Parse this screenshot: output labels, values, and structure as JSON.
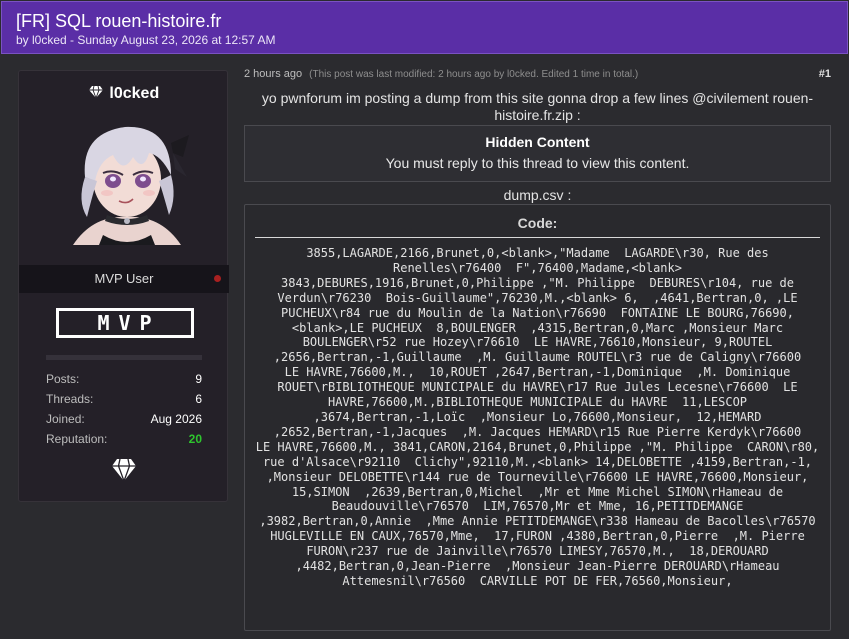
{
  "thread": {
    "title": "[FR] SQL rouen-histoire.fr",
    "byline": "by l0cked - Sunday August 23, 2026 at 12:57 AM"
  },
  "author": {
    "username": "l0cked",
    "rank": "MVP User",
    "badge": "MVP",
    "stats": [
      {
        "label": "Posts:",
        "value": "9"
      },
      {
        "label": "Threads:",
        "value": "6"
      },
      {
        "label": "Joined:",
        "value": "Aug 2026"
      },
      {
        "label": "Reputation:",
        "value": "20"
      }
    ]
  },
  "post": {
    "time_ago": "2 hours ago",
    "edit_note": "(This post was last modified: 2 hours ago by l0cked. Edited 1 time in total.)",
    "number": "#1",
    "message": "yo pwnforum im posting a dump from this site gonna drop a few lines @civilement rouen-histoire.fr.zip :",
    "hidden_title": "Hidden Content",
    "hidden_text": "You must reply to this thread to view this content.",
    "dump_label": "dump.csv :",
    "code_header": "Code:",
    "code": "3855,LAGARDE,2166,Brunet,0,<blank>,\"Madame  LAGARDE\\r30, Rue des Renelles\\r76400  F\",76400,Madame,<blank>\n3843,DEBURES,1916,Brunet,0,Philippe ,\"M. Philippe  DEBURES\\r104, rue de Verdun\\r76230  Bois-Guillaume\",76230,M.,<blank> 6,  ,4641,Bertran,0, ,LE PUCHEUX\\r84 rue du Moulin de la Nation\\r76690  FONTAINE LE BOURG,76690,<blank>,LE PUCHEUX  8,BOULENGER  ,4315,Bertran,0,Marc ,Monsieur Marc BOULENGER\\r52 rue Hozey\\r76610  LE HAVRE,76610,Monsieur, 9,ROUTEL  ,2656,Bertran,-1,Guillaume  ,M. Guillaume ROUTEL\\r3 rue de Caligny\\r76600     LE HAVRE,76600,M.,  10,ROUET ,2647,Bertran,-1,Dominique  ,M. Dominique ROUET\\rBIBLIOTHEQUE MUNICIPALE du HAVRE\\r17 Rue Jules Lecesne\\r76600  LE HAVRE,76600,M.,BIBLIOTHEQUE MUNICIPALE du HAVRE  11,LESCOP  ,3674,Bertran,-1,Loïc  ,Monsieur Lo,76600,Monsieur,  12,HEMARD  ,2652,Bertran,-1,Jacques  ,M. Jacques HEMARD\\r15 Rue Pierre Kerdyk\\r76600     LE HAVRE,76600,M., 3841,CARON,2164,Brunet,0,Philippe ,\"M. Philippe  CARON\\r80, rue d'Alsace\\r92110  Clichy\",92110,M.,<blank> 14,DELOBETTE ,4159,Bertran,-1,  ,Monsieur DELOBETTE\\r144 rue de Tourneville\\r76600 LE HAVRE,76600,Monsieur,  15,SIMON  ,2639,Bertran,0,Michel  ,Mr et Mme Michel SIMON\\rHameau de Beaudouville\\r76570  LIM,76570,Mr et Mme, 16,PETITDEMANGE  ,3982,Bertran,0,Annie  ,Mme Annie PETITDEMANGE\\r338 Hameau de Bacolles\\r76570 HUGLEVILLE EN CAUX,76570,Mme,  17,FURON ,4380,Bertran,0,Pierre  ,M. Pierre FURON\\r237 rue de Jainville\\r76570 LIMESY,76570,M.,  18,DEROUARD  ,4482,Bertran,0,Jean-Pierre  ,Monsieur Jean-Pierre DEROUARD\\rHameau Attemesnil\\r76560  CARVILLE POT DE FER,76560,Monsieur,"
  },
  "icons": {
    "username_prefix": "diamond-icon",
    "sidebar_footer": "diamond-icon"
  },
  "colors": {
    "header_bg": "#5a2ea6",
    "reputation": "#2ec42e",
    "offline_dot": "#a82020"
  }
}
